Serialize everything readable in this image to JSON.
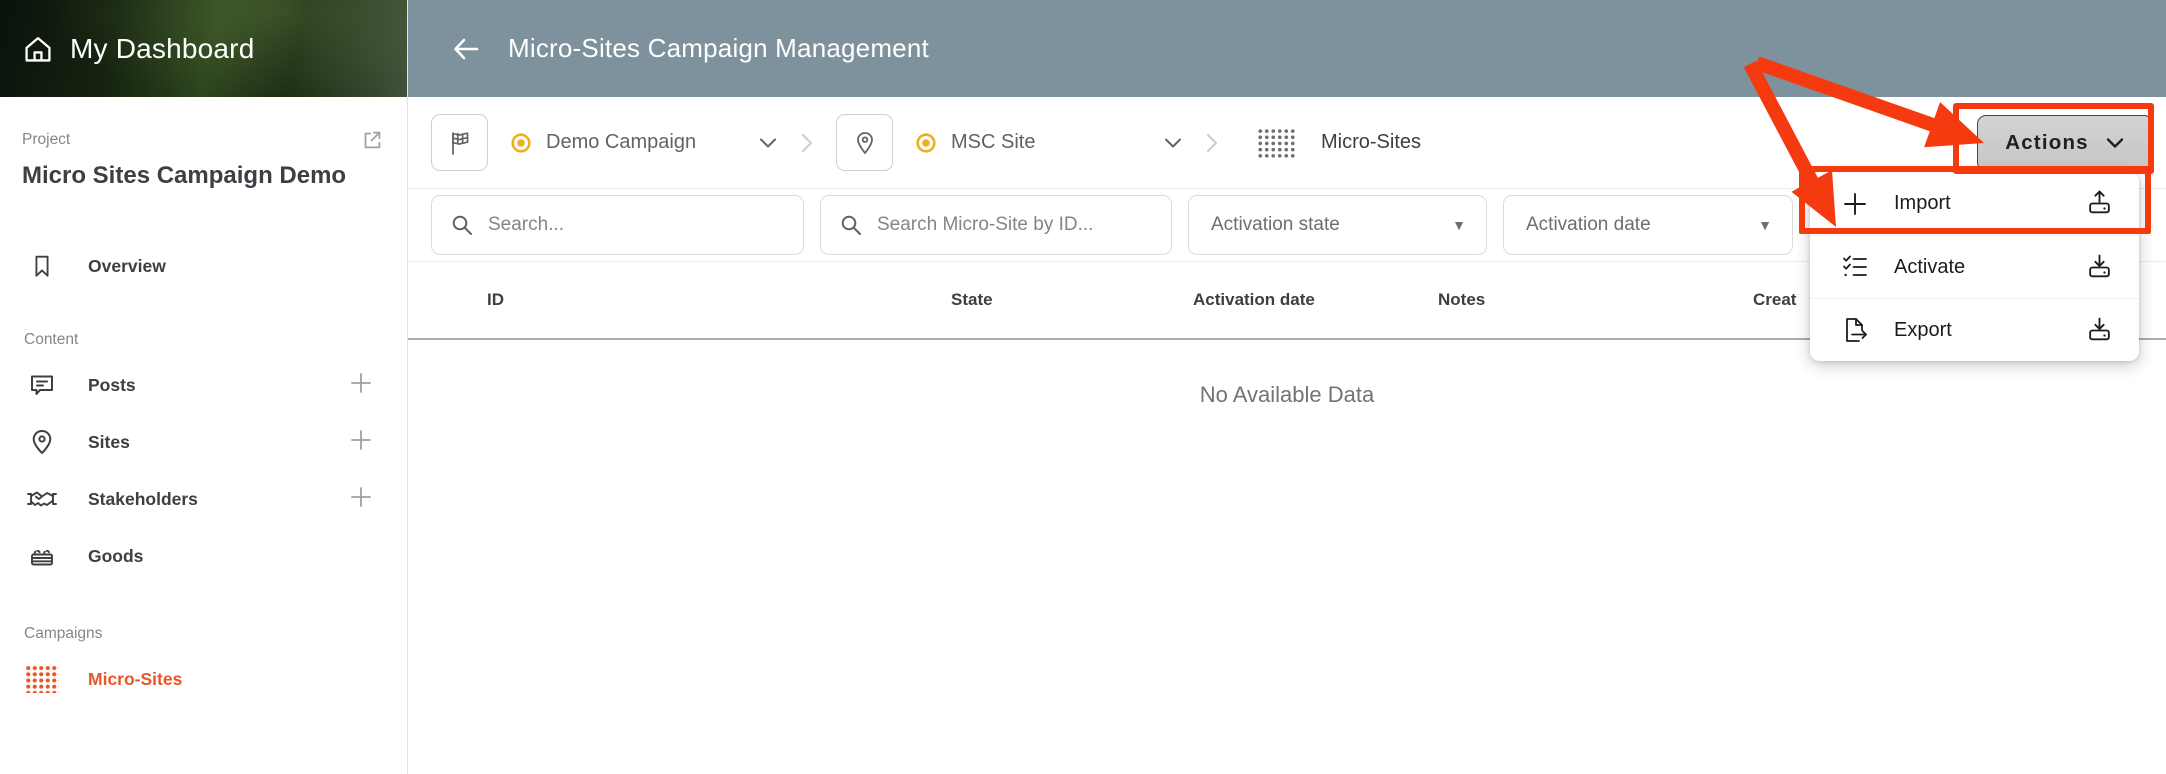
{
  "colors": {
    "header_bg": "#7d929d",
    "accent_orange": "#e8562c",
    "annotation_red": "#f53a0f",
    "selected_yellow": "#f0ad1c",
    "actions_button_bg": "#cacaca"
  },
  "sidebar": {
    "dashboard_title": "My Dashboard",
    "project_label": "Project",
    "project_name": "Micro Sites Campaign Demo",
    "overview_label": "Overview",
    "content_label": "Content",
    "content_items": [
      {
        "label": "Posts",
        "icon": "chat-bubble-icon",
        "has_add": true
      },
      {
        "label": "Sites",
        "icon": "map-pin-icon",
        "has_add": true
      },
      {
        "label": "Stakeholders",
        "icon": "handshake-icon",
        "has_add": true
      },
      {
        "label": "Goods",
        "icon": "crate-icon",
        "has_add": false
      }
    ],
    "campaigns_label": "Campaigns",
    "campaigns_items": [
      {
        "label": "Micro-Sites",
        "icon": "grid-dots-icon",
        "active": true
      }
    ]
  },
  "header": {
    "title": "Micro-Sites Campaign Management"
  },
  "toolbar": {
    "campaign_selector": {
      "value": "Demo Campaign",
      "icon": "flag-icon",
      "state_icon": "selected-dot-icon"
    },
    "site_selector": {
      "value": "MSC Site",
      "icon": "map-pin-icon",
      "state_icon": "selected-dot-icon"
    },
    "section_label": "Micro-Sites",
    "actions_button": {
      "label": "Actions"
    }
  },
  "filters": {
    "search_placeholder": "Search...",
    "id_search_placeholder": "Search Micro-Site by ID...",
    "activation_state_label": "Activation state",
    "activation_date_label": "Activation date"
  },
  "table": {
    "columns": [
      "ID",
      "State",
      "Activation date",
      "Notes",
      "Creat"
    ]
  },
  "empty_state": {
    "message": "No Available Data"
  },
  "actions_menu": {
    "items": [
      {
        "label": "Import",
        "left_icon": "plus-icon",
        "right_icon": "upload-icon",
        "highlighted": true
      },
      {
        "label": "Activate",
        "left_icon": "checklist-icon",
        "right_icon": "download-icon",
        "highlighted": false
      },
      {
        "label": "Export",
        "left_icon": "export-icon",
        "right_icon": "download-icon",
        "highlighted": false
      }
    ]
  }
}
